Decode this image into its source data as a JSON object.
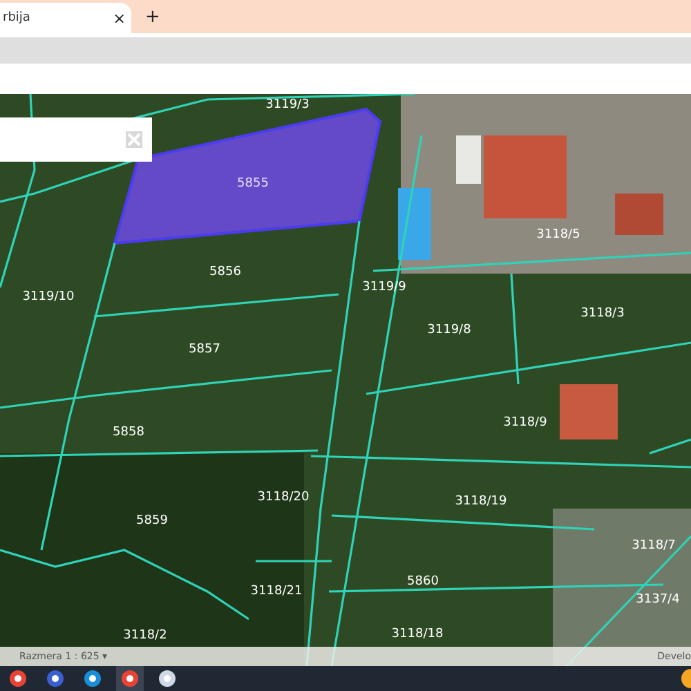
{
  "browser": {
    "tab": {
      "title": "rbija",
      "close": "×",
      "selected": true
    },
    "new_tab": "+"
  },
  "map": {
    "parcels": [
      {
        "label": "3119/3",
        "selected": false
      },
      {
        "label": "5855",
        "selected": true
      },
      {
        "label": "5856",
        "selected": false
      },
      {
        "label": "3119/10",
        "selected": false
      },
      {
        "label": "3119/9",
        "selected": false
      },
      {
        "label": "3118/5",
        "selected": false
      },
      {
        "label": "3119/8",
        "selected": false
      },
      {
        "label": "3118/3",
        "selected": false
      },
      {
        "label": "5857",
        "selected": false
      },
      {
        "label": "3118/9",
        "selected": false
      },
      {
        "label": "5858",
        "selected": false
      },
      {
        "label": "3118/20",
        "selected": false
      },
      {
        "label": "3118/19",
        "selected": false
      },
      {
        "label": "5859",
        "selected": false
      },
      {
        "label": "3118/7",
        "selected": false
      },
      {
        "label": "3118/21",
        "selected": false
      },
      {
        "label": "5860",
        "selected": false
      },
      {
        "label": "3137/4",
        "selected": false
      },
      {
        "label": "3118/2",
        "selected": false
      },
      {
        "label": "3118/18",
        "selected": false
      }
    ]
  },
  "status_bar": {
    "scale": "Razmera 1 : 625",
    "scale_caret": "▾",
    "right_text": "Develo"
  }
}
